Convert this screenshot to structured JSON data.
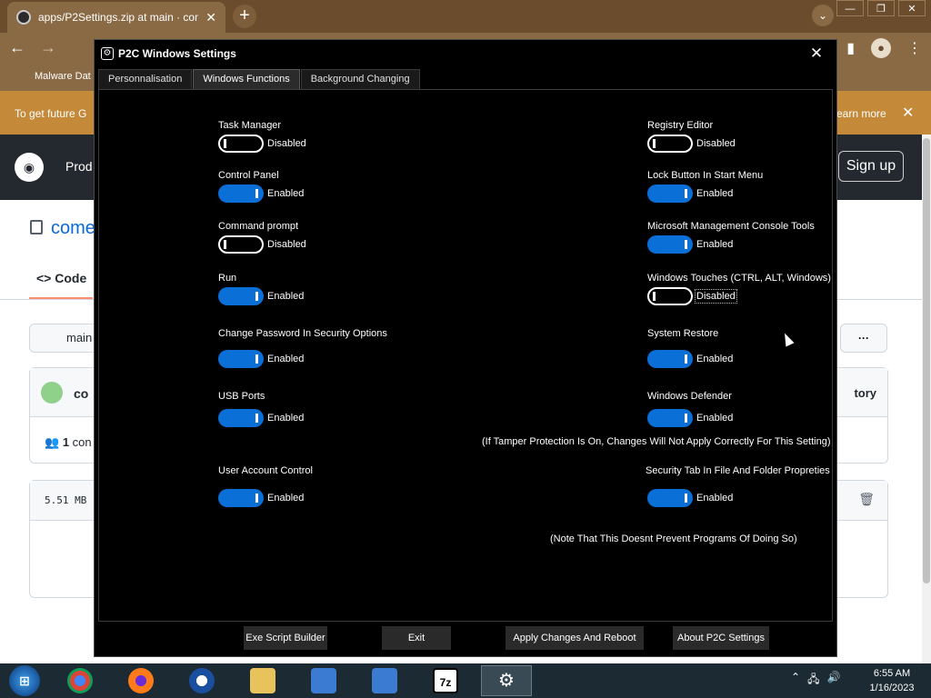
{
  "browser": {
    "tab_title": "apps/P2Settings.zip at main · com",
    "bookmark": "Malware Dat",
    "infobar_text": "To get future G",
    "infobar_link": "earn more",
    "gh_products": "Prod",
    "gh_signup": "Sign up",
    "gh_repo": "come",
    "gh_code_tab": "Code",
    "gh_branch": "main",
    "gh_commit_author": "co",
    "gh_history": "tory",
    "gh_contributors_count": "1",
    "gh_contributors_label": "con",
    "gh_file_size": "5.51 MB"
  },
  "app": {
    "title": "P2C Windows Settings",
    "tabs": [
      "Personnalisation",
      "Windows Functions",
      "Background Changing"
    ],
    "active_tab": 1,
    "settings_left": [
      {
        "label": "Task Manager",
        "enabled": false,
        "status": "Disabled"
      },
      {
        "label": "Control Panel",
        "enabled": true,
        "status": "Enabled"
      },
      {
        "label": "Command prompt",
        "enabled": false,
        "status": "Disabled"
      },
      {
        "label": "Run",
        "enabled": true,
        "status": "Enabled"
      },
      {
        "label": "Change Password In Security Options",
        "enabled": true,
        "status": "Enabled"
      },
      {
        "label": "USB Ports",
        "enabled": true,
        "status": "Enabled"
      },
      {
        "label": "User Account Control",
        "enabled": true,
        "status": "Enabled"
      }
    ],
    "settings_right": [
      {
        "label": "Registry Editor",
        "enabled": false,
        "status": "Disabled"
      },
      {
        "label": "Lock Button In Start Menu",
        "enabled": true,
        "status": "Enabled"
      },
      {
        "label": "Microsoft Management Console Tools",
        "enabled": true,
        "status": "Enabled"
      },
      {
        "label": "Windows Touches (CTRL, ALT, Windows)",
        "enabled": false,
        "status": "Disabled"
      },
      {
        "label": "System Restore",
        "enabled": true,
        "status": "Enabled"
      },
      {
        "label": "Windows Defender",
        "enabled": true,
        "status": "Enabled"
      },
      {
        "label": "Security Tab In File And Folder Propreties",
        "enabled": true,
        "status": "Enabled"
      }
    ],
    "defender_note": "(If Tamper Protection Is On, Changes Will Not Apply Correctly For This Setting)",
    "security_note": "(Note That This Doesnt Prevent Programs Of Doing So)",
    "buttons": {
      "exe_builder": "Exe Script Builder",
      "exit": "Exit",
      "apply": "Apply Changes And Reboot",
      "about": "About P2C Settings"
    }
  },
  "taskbar": {
    "items": [
      "chrome-icon",
      "firefox-icon",
      "obama-icon",
      "file-explorer-icon",
      "installer-icon",
      "installer-icon",
      "7zip-icon",
      "settings-icon"
    ],
    "sevenzip_label": "7z",
    "time": "6:55 AM",
    "date": "1/16/2023"
  }
}
